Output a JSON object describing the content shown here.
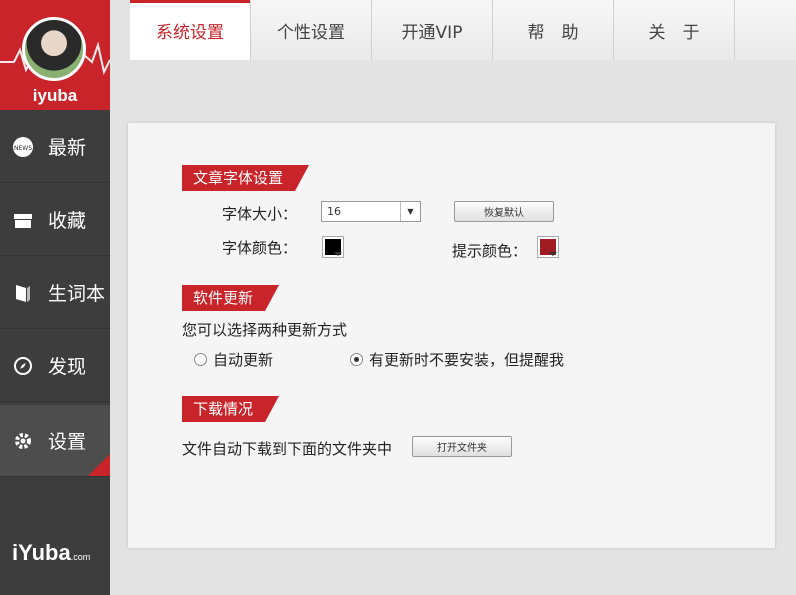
{
  "user": {
    "name": "iyuba"
  },
  "sidebar": {
    "items": [
      {
        "label": "最新",
        "icon": "news-icon"
      },
      {
        "label": "收藏",
        "icon": "collection-box-icon"
      },
      {
        "label": "生词本",
        "icon": "book-icon"
      },
      {
        "label": "发现",
        "icon": "compass-icon"
      },
      {
        "label": "设置",
        "icon": "gear-icon"
      }
    ],
    "active": "设置",
    "brand": "iYuba",
    "brand_suffix": ".com"
  },
  "tabs": [
    "系统设置",
    "个性设置",
    "开通VIP",
    "帮　助",
    "关　于"
  ],
  "active_tab": "系统设置",
  "font_section": {
    "title": "文章字体设置",
    "size_label": "字体大小：",
    "size_value": "16",
    "reset_button": "恢复默认",
    "color_label": "字体颜色：",
    "color_value": "#000000",
    "hint_label": "提示颜色：",
    "hint_value": "#a01c22"
  },
  "update_section": {
    "title": "软件更新",
    "description": "您可以选择两种更新方式",
    "option_auto": "自动更新",
    "option_notify": "有更新时不要安装，但提醒我",
    "selected": "notify"
  },
  "download_section": {
    "title": "下载情况",
    "description": "文件自动下载到下面的文件夹中",
    "open_button": "打开文件夹"
  },
  "colors": {
    "accent": "#c9242a",
    "sidebar": "#3d3d3d"
  }
}
